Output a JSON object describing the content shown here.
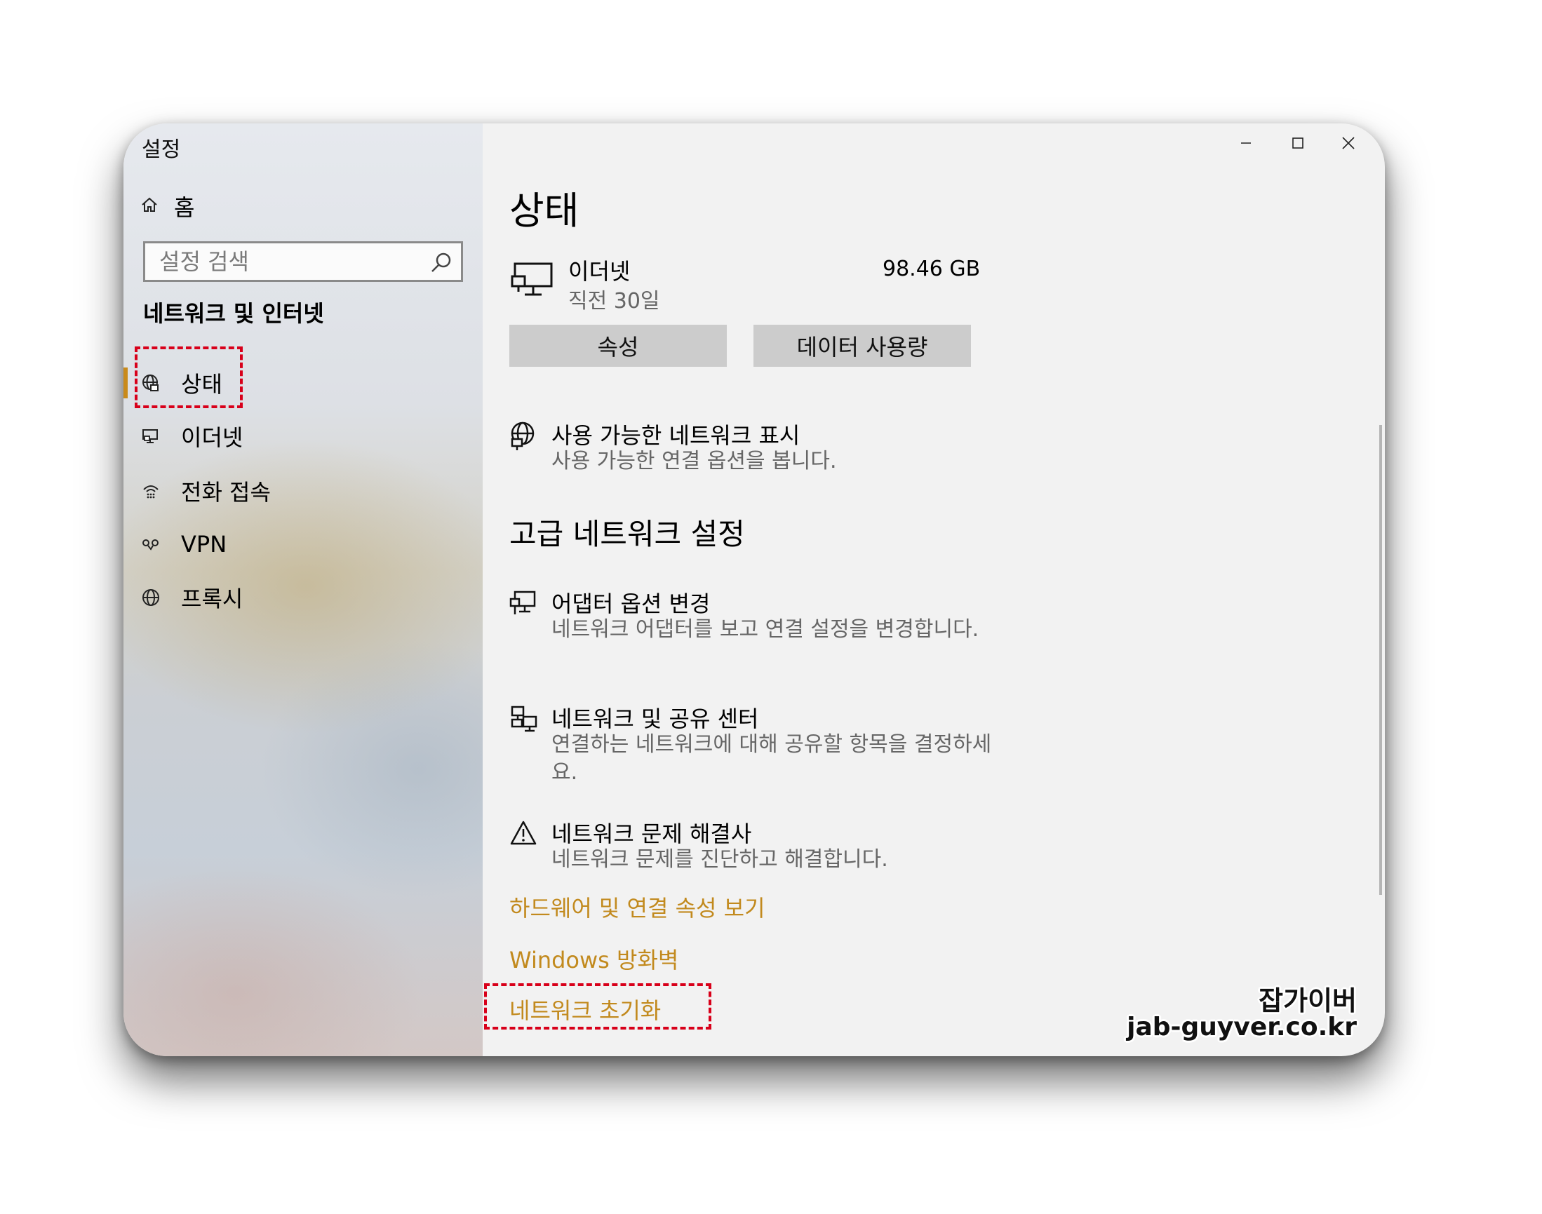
{
  "window": {
    "title": "설정"
  },
  "sidebar": {
    "home_label": "홈",
    "search": {
      "placeholder": "설정 검색"
    },
    "section_title": "네트워크 및 인터넷",
    "items": [
      {
        "icon": "globe-network-icon",
        "label": "상태",
        "active": true
      },
      {
        "icon": "ethernet-icon",
        "label": "이더넷"
      },
      {
        "icon": "dialup-icon",
        "label": "전화 접속"
      },
      {
        "icon": "vpn-icon",
        "label": "VPN"
      },
      {
        "icon": "globe-icon",
        "label": "프록시"
      }
    ]
  },
  "main": {
    "title": "상태",
    "connection": {
      "name": "이더넷",
      "status": "직전 30일",
      "usage": "98.46 GB"
    },
    "buttons": {
      "properties": "속성",
      "data_usage": "데이터 사용량"
    },
    "show_networks": {
      "title": "사용 가능한 네트워크 표시",
      "desc": "사용 가능한 연결 옵션을 봅니다."
    },
    "advanced_title": "고급 네트워크 설정",
    "options": [
      {
        "icon": "adapter-icon",
        "title": "어댑터 옵션 변경",
        "desc": "네트워크 어댑터를 보고 연결 설정을 변경합니다."
      },
      {
        "icon": "sharing-center-icon",
        "title": "네트워크 및 공유 센터",
        "desc": "연결하는 네트워크에 대해 공유할 항목을 결정하세요."
      },
      {
        "icon": "warning-icon",
        "title": "네트워크 문제 해결사",
        "desc": "네트워크 문제를 진단하고 해결합니다."
      }
    ],
    "links": {
      "hardware": "하드웨어 및 연결 속성 보기",
      "firewall": "Windows 방화벽",
      "reset": "네트워크 초기화"
    }
  },
  "watermark": {
    "line1": "잡가이버",
    "line2": "jab-guyver.co.kr"
  },
  "colors": {
    "accent": "#c98a1a",
    "link": "#c28a1e",
    "highlight": "#d8001a"
  }
}
